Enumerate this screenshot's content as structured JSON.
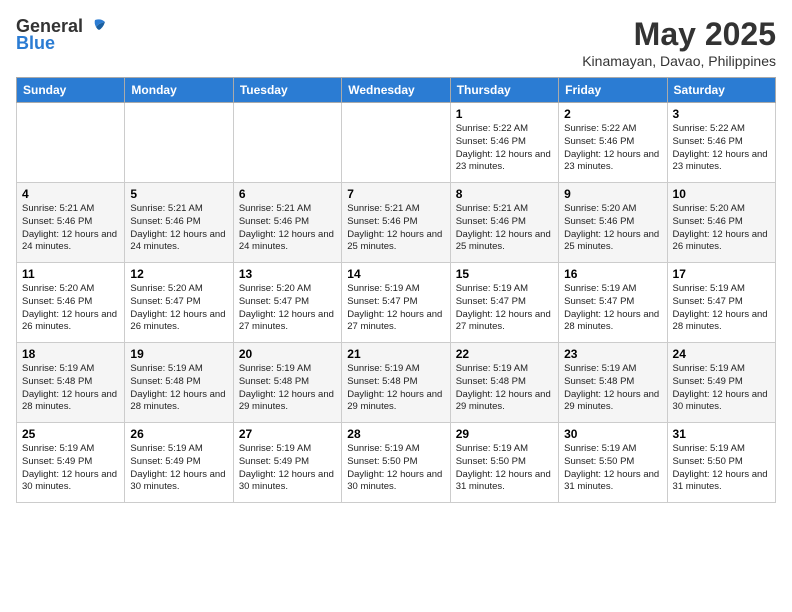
{
  "header": {
    "logo_general": "General",
    "logo_blue": "Blue",
    "month_year": "May 2025",
    "location": "Kinamayan, Davao, Philippines"
  },
  "days_of_week": [
    "Sunday",
    "Monday",
    "Tuesday",
    "Wednesday",
    "Thursday",
    "Friday",
    "Saturday"
  ],
  "weeks": [
    [
      {
        "day": "",
        "sunrise": "",
        "sunset": "",
        "daylight": ""
      },
      {
        "day": "",
        "sunrise": "",
        "sunset": "",
        "daylight": ""
      },
      {
        "day": "",
        "sunrise": "",
        "sunset": "",
        "daylight": ""
      },
      {
        "day": "",
        "sunrise": "",
        "sunset": "",
        "daylight": ""
      },
      {
        "day": "1",
        "sunrise": "Sunrise: 5:22 AM",
        "sunset": "Sunset: 5:46 PM",
        "daylight": "Daylight: 12 hours and 23 minutes."
      },
      {
        "day": "2",
        "sunrise": "Sunrise: 5:22 AM",
        "sunset": "Sunset: 5:46 PM",
        "daylight": "Daylight: 12 hours and 23 minutes."
      },
      {
        "day": "3",
        "sunrise": "Sunrise: 5:22 AM",
        "sunset": "Sunset: 5:46 PM",
        "daylight": "Daylight: 12 hours and 23 minutes."
      }
    ],
    [
      {
        "day": "4",
        "sunrise": "Sunrise: 5:21 AM",
        "sunset": "Sunset: 5:46 PM",
        "daylight": "Daylight: 12 hours and 24 minutes."
      },
      {
        "day": "5",
        "sunrise": "Sunrise: 5:21 AM",
        "sunset": "Sunset: 5:46 PM",
        "daylight": "Daylight: 12 hours and 24 minutes."
      },
      {
        "day": "6",
        "sunrise": "Sunrise: 5:21 AM",
        "sunset": "Sunset: 5:46 PM",
        "daylight": "Daylight: 12 hours and 24 minutes."
      },
      {
        "day": "7",
        "sunrise": "Sunrise: 5:21 AM",
        "sunset": "Sunset: 5:46 PM",
        "daylight": "Daylight: 12 hours and 25 minutes."
      },
      {
        "day": "8",
        "sunrise": "Sunrise: 5:21 AM",
        "sunset": "Sunset: 5:46 PM",
        "daylight": "Daylight: 12 hours and 25 minutes."
      },
      {
        "day": "9",
        "sunrise": "Sunrise: 5:20 AM",
        "sunset": "Sunset: 5:46 PM",
        "daylight": "Daylight: 12 hours and 25 minutes."
      },
      {
        "day": "10",
        "sunrise": "Sunrise: 5:20 AM",
        "sunset": "Sunset: 5:46 PM",
        "daylight": "Daylight: 12 hours and 26 minutes."
      }
    ],
    [
      {
        "day": "11",
        "sunrise": "Sunrise: 5:20 AM",
        "sunset": "Sunset: 5:46 PM",
        "daylight": "Daylight: 12 hours and 26 minutes."
      },
      {
        "day": "12",
        "sunrise": "Sunrise: 5:20 AM",
        "sunset": "Sunset: 5:47 PM",
        "daylight": "Daylight: 12 hours and 26 minutes."
      },
      {
        "day": "13",
        "sunrise": "Sunrise: 5:20 AM",
        "sunset": "Sunset: 5:47 PM",
        "daylight": "Daylight: 12 hours and 27 minutes."
      },
      {
        "day": "14",
        "sunrise": "Sunrise: 5:19 AM",
        "sunset": "Sunset: 5:47 PM",
        "daylight": "Daylight: 12 hours and 27 minutes."
      },
      {
        "day": "15",
        "sunrise": "Sunrise: 5:19 AM",
        "sunset": "Sunset: 5:47 PM",
        "daylight": "Daylight: 12 hours and 27 minutes."
      },
      {
        "day": "16",
        "sunrise": "Sunrise: 5:19 AM",
        "sunset": "Sunset: 5:47 PM",
        "daylight": "Daylight: 12 hours and 28 minutes."
      },
      {
        "day": "17",
        "sunrise": "Sunrise: 5:19 AM",
        "sunset": "Sunset: 5:47 PM",
        "daylight": "Daylight: 12 hours and 28 minutes."
      }
    ],
    [
      {
        "day": "18",
        "sunrise": "Sunrise: 5:19 AM",
        "sunset": "Sunset: 5:48 PM",
        "daylight": "Daylight: 12 hours and 28 minutes."
      },
      {
        "day": "19",
        "sunrise": "Sunrise: 5:19 AM",
        "sunset": "Sunset: 5:48 PM",
        "daylight": "Daylight: 12 hours and 28 minutes."
      },
      {
        "day": "20",
        "sunrise": "Sunrise: 5:19 AM",
        "sunset": "Sunset: 5:48 PM",
        "daylight": "Daylight: 12 hours and 29 minutes."
      },
      {
        "day": "21",
        "sunrise": "Sunrise: 5:19 AM",
        "sunset": "Sunset: 5:48 PM",
        "daylight": "Daylight: 12 hours and 29 minutes."
      },
      {
        "day": "22",
        "sunrise": "Sunrise: 5:19 AM",
        "sunset": "Sunset: 5:48 PM",
        "daylight": "Daylight: 12 hours and 29 minutes."
      },
      {
        "day": "23",
        "sunrise": "Sunrise: 5:19 AM",
        "sunset": "Sunset: 5:48 PM",
        "daylight": "Daylight: 12 hours and 29 minutes."
      },
      {
        "day": "24",
        "sunrise": "Sunrise: 5:19 AM",
        "sunset": "Sunset: 5:49 PM",
        "daylight": "Daylight: 12 hours and 30 minutes."
      }
    ],
    [
      {
        "day": "25",
        "sunrise": "Sunrise: 5:19 AM",
        "sunset": "Sunset: 5:49 PM",
        "daylight": "Daylight: 12 hours and 30 minutes."
      },
      {
        "day": "26",
        "sunrise": "Sunrise: 5:19 AM",
        "sunset": "Sunset: 5:49 PM",
        "daylight": "Daylight: 12 hours and 30 minutes."
      },
      {
        "day": "27",
        "sunrise": "Sunrise: 5:19 AM",
        "sunset": "Sunset: 5:49 PM",
        "daylight": "Daylight: 12 hours and 30 minutes."
      },
      {
        "day": "28",
        "sunrise": "Sunrise: 5:19 AM",
        "sunset": "Sunset: 5:50 PM",
        "daylight": "Daylight: 12 hours and 30 minutes."
      },
      {
        "day": "29",
        "sunrise": "Sunrise: 5:19 AM",
        "sunset": "Sunset: 5:50 PM",
        "daylight": "Daylight: 12 hours and 31 minutes."
      },
      {
        "day": "30",
        "sunrise": "Sunrise: 5:19 AM",
        "sunset": "Sunset: 5:50 PM",
        "daylight": "Daylight: 12 hours and 31 minutes."
      },
      {
        "day": "31",
        "sunrise": "Sunrise: 5:19 AM",
        "sunset": "Sunset: 5:50 PM",
        "daylight": "Daylight: 12 hours and 31 minutes."
      }
    ]
  ]
}
